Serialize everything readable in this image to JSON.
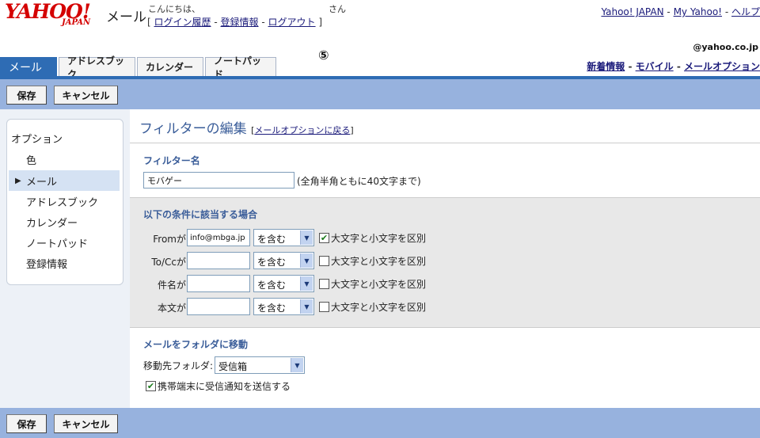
{
  "header": {
    "logo_text": "YAHOO!",
    "logo_sub": "JAPAN",
    "app_title": "メール",
    "greeting": "こんにちは、",
    "san": "さん",
    "links": {
      "open_bracket": "[",
      "login_history": "ログイン履歴",
      "sep1": "-",
      "reg_info": "登録情報",
      "sep2": "-",
      "logout": "ログアウト",
      "close_bracket": "]"
    },
    "top_links": {
      "yahoo_japan": "Yahoo! JAPAN",
      "sep1": "-",
      "my_yahoo": "My Yahoo!",
      "sep2": "-",
      "help": "ヘルプ"
    },
    "email_domain": "@yahoo.co.jp",
    "step_mark": "⑤"
  },
  "tabs": [
    {
      "label": "メール"
    },
    {
      "label": "アドレスブック"
    },
    {
      "label": "カレンダー"
    },
    {
      "label": "ノートパッド"
    }
  ],
  "sub_links": {
    "new_info": "新着情報",
    "sep1": "-",
    "mobile": "モバイル",
    "sep2": "-",
    "mail_options": "メールオプション"
  },
  "toolbar": {
    "save_label": "保存",
    "cancel_label": "キャンセル"
  },
  "sidebar": {
    "title": "オプション",
    "items": [
      {
        "label": "色"
      },
      {
        "label": "メール"
      },
      {
        "label": "アドレスブック"
      },
      {
        "label": "カレンダー"
      },
      {
        "label": "ノートパッド"
      },
      {
        "label": "登録情報"
      }
    ]
  },
  "main": {
    "title": "フィルターの編集",
    "back_open": "[",
    "back_link": "メールオプションに戻る",
    "back_close": "]",
    "filter_name_label": "フィルター名",
    "filter_name_value": "モバゲー",
    "filter_name_note": "(全角半角ともに40文字まで)",
    "conditions_label": "以下の条件に該当する場合",
    "conditions": [
      {
        "label": "Fromが",
        "value": "info@mbga.jp",
        "operator": "を含む",
        "case_label": "大文字と小文字を区別",
        "checked": true
      },
      {
        "label": "To/Ccが",
        "value": "",
        "operator": "を含む",
        "case_label": "大文字と小文字を区別",
        "checked": false
      },
      {
        "label": "件名が",
        "value": "",
        "operator": "を含む",
        "case_label": "大文字と小文字を区別",
        "checked": false
      },
      {
        "label": "本文が",
        "value": "",
        "operator": "を含む",
        "case_label": "大文字と小文字を区別",
        "checked": false
      }
    ],
    "move_label": "メールをフォルダに移動",
    "folder_label": "移動先フォルダ:",
    "folder_value": "受信箱",
    "notify_label": "携帯端末に受信通知を送信する",
    "notify_checked": true
  },
  "icons": {
    "select_arrow": "chevron-down-icon",
    "checkmark": "check-icon",
    "bullet": "triangle-right-icon"
  },
  "colors": {
    "accent": "#2e6cb4",
    "toolbar": "#97b2de",
    "title": "#3a5d99",
    "brand": "#d40000"
  }
}
